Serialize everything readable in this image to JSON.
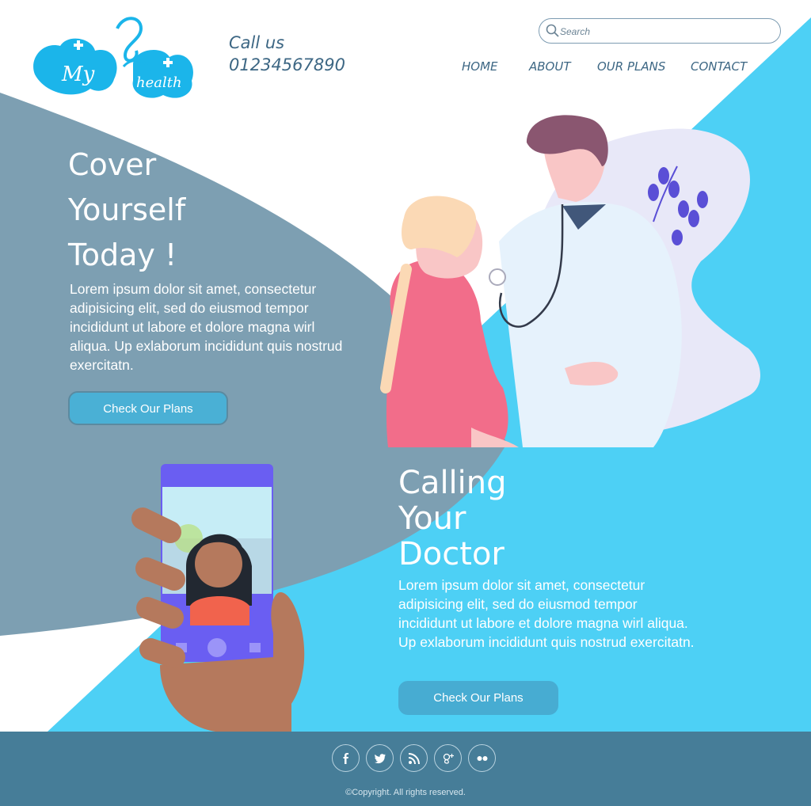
{
  "brand": {
    "logo_text_1": "My",
    "logo_text_2": "health",
    "color_logo": "#1bb5ea"
  },
  "header": {
    "call_label": "Call us",
    "phone": "01234567890",
    "search_placeholder": "Search",
    "nav": [
      "HOME",
      "ABOUT",
      "OUR PLANS",
      "CONTACT"
    ]
  },
  "hero": {
    "title_lines": [
      "Cover",
      "Yourself",
      "Today !"
    ],
    "text": "Lorem ipsum dolor sit amet, consectetur adipisicing elit, sed do eiusmod tempor incididunt ut labore et dolore magna wirl aliqua. Up exlaborum incididunt quis nostrud exercitatn.",
    "button": "Check Our Plans"
  },
  "calling": {
    "title_lines": [
      "Calling",
      "Your",
      "Doctor"
    ],
    "text": "Lorem ipsum dolor sit amet, consectetur adipisicing elit, sed do eiusmod tempor incididunt ut labore et dolore magna wirl aliqua. Up exlaborum incididunt quis nostrud exercitatn.",
    "button": "Check Our Plans"
  },
  "footer": {
    "social_icons": [
      "facebook-icon",
      "twitter-icon",
      "rss-icon",
      "google-plus-icon",
      "flickr-icon"
    ],
    "copyright": "©Copyright. All rights reserved."
  },
  "colors": {
    "slate": "#7d9fb2",
    "sky": "#4dd0f5",
    "footer": "#467d98",
    "nav_text": "#3d6784",
    "button": "#4ab0d5"
  }
}
